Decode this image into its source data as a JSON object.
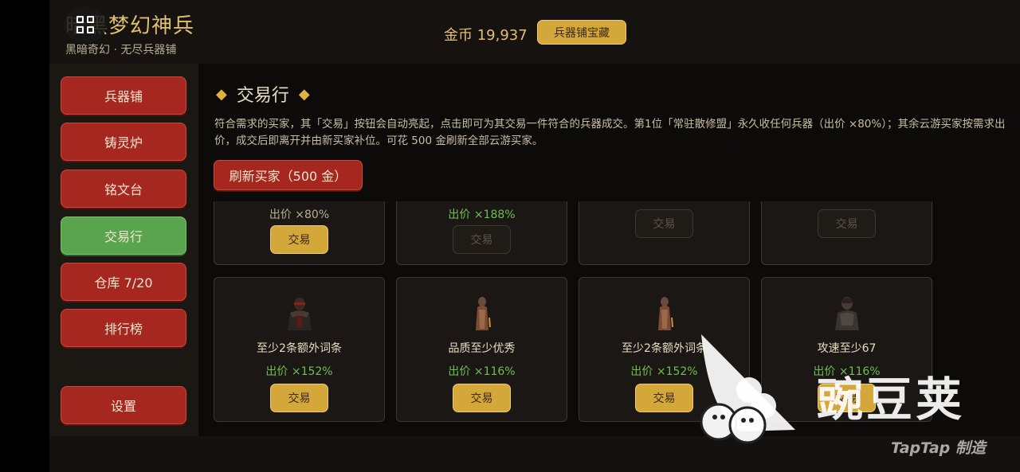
{
  "header": {
    "game_title": "暗黑梦幻神兵",
    "subtitle": "黑暗奇幻 · 无尽兵器铺",
    "gold_label": "金币 19,937",
    "treasure_button": "兵器铺宝藏"
  },
  "sidebar": {
    "items": [
      {
        "label": "兵器铺",
        "active": false
      },
      {
        "label": "铸灵炉",
        "active": false
      },
      {
        "label": "铭文台",
        "active": false
      },
      {
        "label": "交易行",
        "active": true
      },
      {
        "label": "仓库 7/20",
        "active": false
      },
      {
        "label": "排行榜",
        "active": false
      }
    ],
    "settings_label": "设置"
  },
  "main": {
    "title": "交易行",
    "diamond": "◆",
    "description": "符合需求的买家，其「交易」按钮会自动亮起，点击即可为其交易一件符合的兵器成交。第1位「常驻散修盟」永久收任何兵器（出价 ×80%）；其余云游买家按需求出价，成交后即离开并由新买家补位。可花 500 金刷新全部云游买家。",
    "refresh_button": "刷新买家（500 金）",
    "trade_label": "交易",
    "top_row": [
      {
        "price": "出价 ×80%",
        "enabled": true
      },
      {
        "price": "出价 ×188%",
        "enabled": false
      },
      {
        "price": "",
        "enabled": false
      },
      {
        "price": "",
        "enabled": false
      }
    ],
    "bottom_row": [
      {
        "requirement": "至少2条额外词条",
        "price": "出价 ×152%",
        "enabled": true,
        "portrait": "armored-warrior-icon"
      },
      {
        "requirement": "品质至少优秀",
        "price": "出价 ×116%",
        "enabled": true,
        "portrait": "robed-merchant-icon"
      },
      {
        "requirement": "至少2条额外词条",
        "price": "出价 ×152%",
        "enabled": true,
        "portrait": "robed-merchant-icon"
      },
      {
        "requirement": "攻速至少67",
        "price": "出价 ×116%",
        "enabled": true,
        "portrait": "hooded-rogue-icon"
      }
    ]
  },
  "watermark": {
    "brand": "豌豆荚",
    "taptap": "TapTap 制造"
  },
  "colors": {
    "accent_gold": "#d4a73a",
    "nav_red": "#a5271f",
    "nav_active_green": "#5aa34f",
    "price_green": "#6fbf50"
  }
}
